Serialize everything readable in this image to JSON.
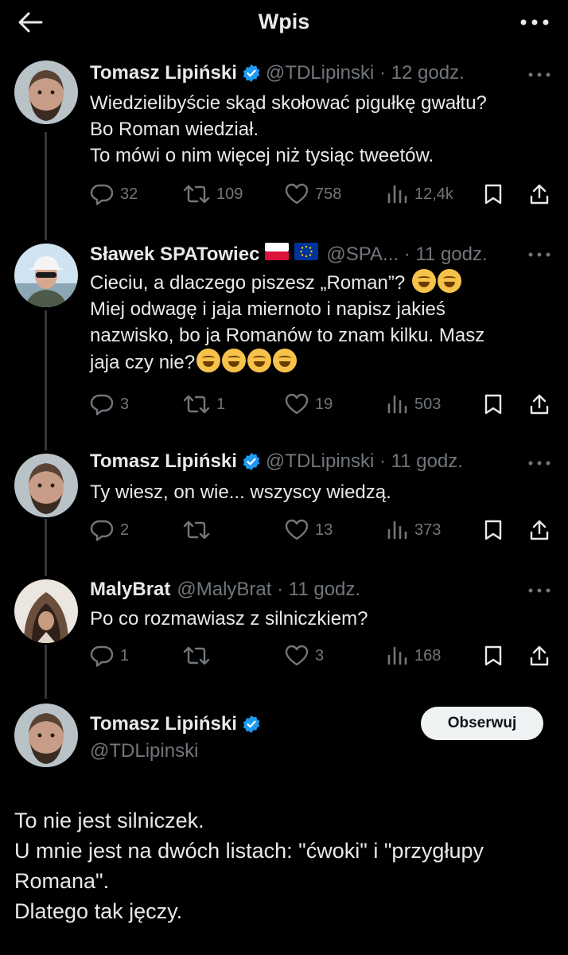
{
  "header": {
    "title": "Wpis"
  },
  "replies": [
    {
      "name": "Tomasz Lipiński",
      "verified": true,
      "handle": "@TDLipinski",
      "time": "12 godz.",
      "text": [
        "Wiedzielibyście skąd skołować pigułkę gwałtu?",
        "Bo Roman wiedział.",
        "To mówi o nim więcej niż tysiąc tweetów."
      ],
      "replies": "32",
      "reposts": "109",
      "likes": "758",
      "views": "12,4k"
    },
    {
      "name": "Sławek SPATowiec",
      "flags": [
        "flag-poland-icon",
        "flag-eu-icon"
      ],
      "handle": "@SPA...",
      "time": "11 godz.",
      "text": [
        "Cieciu, a dlaczego piszesz „Roman”?",
        "Miej odwagę i jaja miernoto i napisz jakieś",
        "nazwisko, bo ja Romanów to znam kilku. Masz",
        "jaja czy nie?"
      ],
      "emoji_icon": "face-with-tears-of-joy-icon",
      "replies": "3",
      "reposts": "1",
      "likes": "19",
      "views": "503"
    },
    {
      "name": "Tomasz Lipiński",
      "verified": true,
      "handle": "@TDLipinski",
      "time": "11 godz.",
      "text": [
        "Ty wiesz, on wie... wszyscy wiedzą."
      ],
      "replies": "2",
      "reposts": "",
      "likes": "13",
      "views": "373"
    },
    {
      "name": "MalyBrat",
      "handle": "@MalyBrat",
      "time": "11 godz.",
      "text": [
        "Po co rozmawiasz z silniczkiem?"
      ],
      "replies": "1",
      "reposts": "",
      "likes": "3",
      "views": "168"
    }
  ],
  "main_post": {
    "name": "Tomasz Lipiński",
    "verified": true,
    "handle": "@TDLipinski",
    "follow_label": "Obserwuj",
    "text": [
      "To nie jest silniczek.",
      "U mnie jest na dwóch listach: \"ćwoki\" i \"przygłupy",
      "Romana\".",
      "Dlatego tak jęczy."
    ]
  },
  "colors": {
    "background": "#000000",
    "text": "#e7e9ea",
    "muted": "#71767b",
    "verified": "#1d9bf0",
    "thread_line": "#333639"
  },
  "icons": {
    "back": "arrow-left-icon",
    "more": "more-horizontal-icon",
    "reply": "reply-icon",
    "repost": "repost-icon",
    "like": "heart-icon",
    "views": "views-icon",
    "bookmark": "bookmark-icon",
    "share": "share-icon"
  }
}
